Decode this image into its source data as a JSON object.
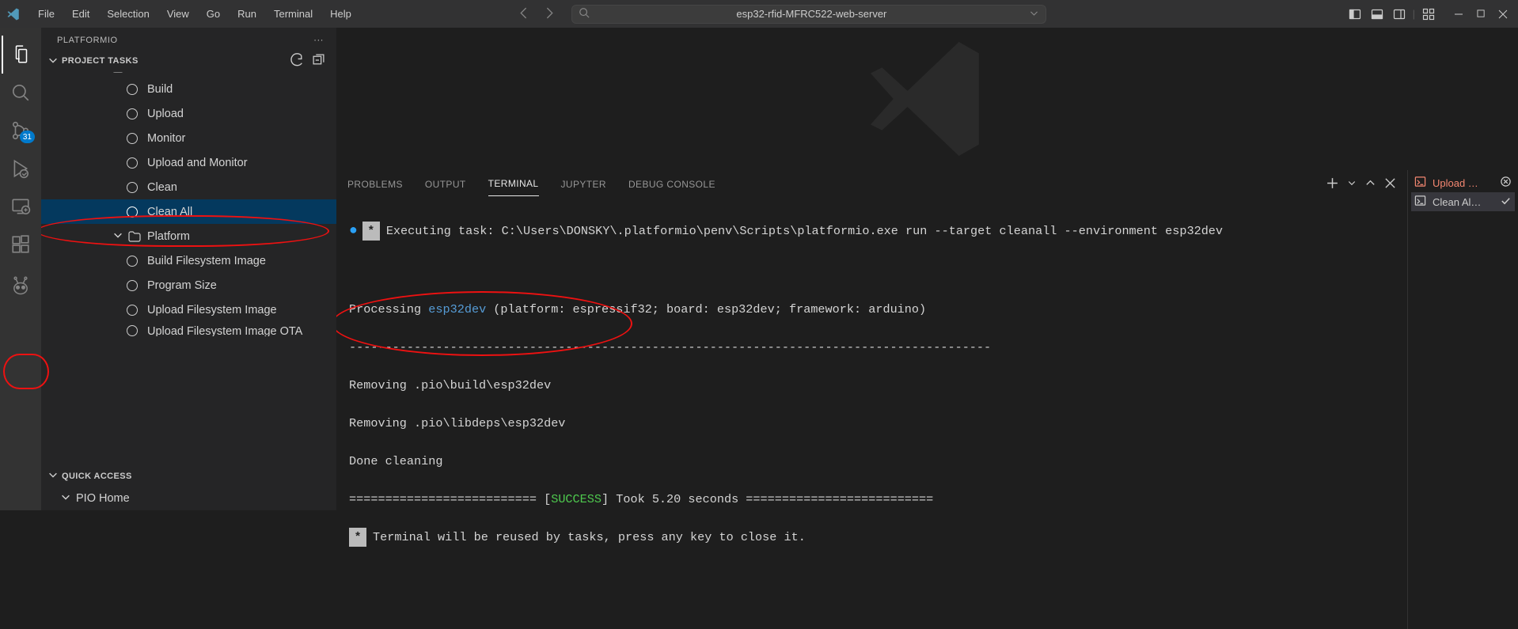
{
  "titlebar": {
    "menu": [
      "File",
      "Edit",
      "Selection",
      "View",
      "Go",
      "Run",
      "Terminal",
      "Help"
    ],
    "search_text": "esp32-rfid-MFRC522-web-server"
  },
  "activity_bar": {
    "scm_badge": "31"
  },
  "sidebar": {
    "title": "PLATFORMIO",
    "section_title": "PROJECT TASKS",
    "cut_top_label": "General",
    "tasks": [
      {
        "label": "Build"
      },
      {
        "label": "Upload"
      },
      {
        "label": "Monitor"
      },
      {
        "label": "Upload and Monitor"
      },
      {
        "label": "Clean"
      },
      {
        "label": "Clean All",
        "active": true
      }
    ],
    "platform_folder": "Platform",
    "platform_items": [
      "Build Filesystem Image",
      "Program Size",
      "Upload Filesystem Image",
      "Upload Filesystem Image OTA"
    ],
    "quick_access": "QUICK ACCESS",
    "pio_home": "PIO Home"
  },
  "panel": {
    "tabs": [
      "PROBLEMS",
      "OUTPUT",
      "TERMINAL",
      "JUPYTER",
      "DEBUG CONSOLE"
    ],
    "active_tab": "TERMINAL",
    "right_items": [
      {
        "label": "Upload …",
        "status": "err"
      },
      {
        "label": "Clean Al…",
        "status": "ok"
      }
    ]
  },
  "terminal": {
    "star": "*",
    "exec_prefix": "Executing task: ",
    "exec_cmd": "C:\\Users\\DONSKY\\.platformio\\penv\\Scripts\\platformio.exe run --target cleanall --environment esp32dev ",
    "processing_a": "Processing ",
    "processing_env": "esp32dev",
    "processing_b": " (platform: espressif32; board: esp32dev; framework: arduino)",
    "dashes1": "-----------------------------------------------------------------------------------------",
    "remove1": "Removing .pio\\build\\esp32dev",
    "remove2": "Removing .pio\\libdeps\\esp32dev",
    "done": "Done cleaning",
    "eq_left": "========================== [",
    "success": "SUCCESS",
    "eq_right": "] Took 5.20 seconds ==========================",
    "reuse": "Terminal will be reused by tasks, press any key to close it."
  }
}
